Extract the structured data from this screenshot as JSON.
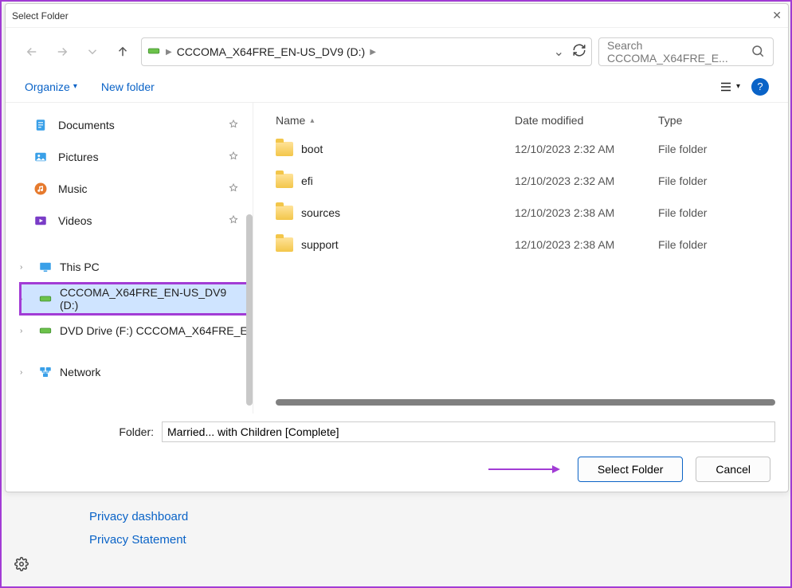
{
  "dialog": {
    "title": "Select Folder",
    "folder_label": "Folder:",
    "folder_value": "Married... with Children [Complete]",
    "select_btn": "Select Folder",
    "cancel_btn": "Cancel"
  },
  "nav": {
    "breadcrumb": "CCCOMA_X64FRE_EN-US_DV9 (D:)",
    "search_placeholder": "Search CCCOMA_X64FRE_E..."
  },
  "toolbar": {
    "organize": "Organize",
    "newfolder": "New folder"
  },
  "quick": [
    {
      "label": "Documents",
      "icon": "documents"
    },
    {
      "label": "Pictures",
      "icon": "pictures"
    },
    {
      "label": "Music",
      "icon": "music"
    },
    {
      "label": "Videos",
      "icon": "videos"
    }
  ],
  "tree": [
    {
      "label": "This PC",
      "icon": "pc",
      "selected": false
    },
    {
      "label": "CCCOMA_X64FRE_EN-US_DV9 (D:)",
      "icon": "drive",
      "selected": true
    },
    {
      "label": "DVD Drive (F:) CCCOMA_X64FRE_E",
      "icon": "drive",
      "selected": false
    },
    {
      "label": "Network",
      "icon": "network",
      "selected": false
    }
  ],
  "cols": {
    "name": "Name",
    "date": "Date modified",
    "type": "Type"
  },
  "files": [
    {
      "name": "boot",
      "date": "12/10/2023 2:32 AM",
      "type": "File folder"
    },
    {
      "name": "efi",
      "date": "12/10/2023 2:32 AM",
      "type": "File folder"
    },
    {
      "name": "sources",
      "date": "12/10/2023 2:38 AM",
      "type": "File folder"
    },
    {
      "name": "support",
      "date": "12/10/2023 2:38 AM",
      "type": "File folder"
    }
  ],
  "bg_links": [
    "Privacy dashboard",
    "Privacy Statement"
  ]
}
